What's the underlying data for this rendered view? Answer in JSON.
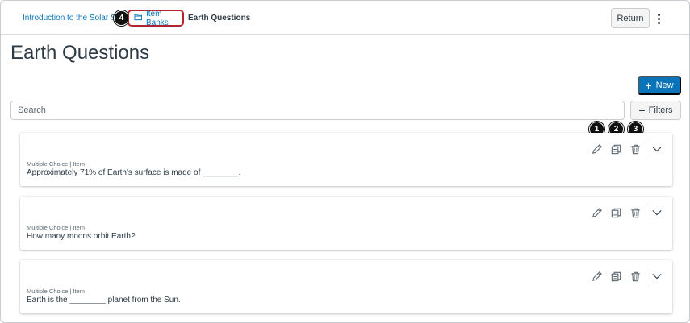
{
  "breadcrumb": {
    "course": "Introduction to the Solar System",
    "item_banks": "Item Banks",
    "current": "Earth Questions"
  },
  "header": {
    "return_label": "Return"
  },
  "page_title": "Earth Questions",
  "toolbar": {
    "new_label": "New",
    "search_placeholder": "Search",
    "filters_label": "Filters"
  },
  "markers": [
    "1",
    "2",
    "3",
    "4"
  ],
  "items": [
    {
      "meta": "Multiple Choice | Item",
      "text": "Approximately 71% of Earth's surface is made of ________."
    },
    {
      "meta": "Multiple Choice | Item",
      "text": "How many moons orbit Earth?"
    },
    {
      "meta": "Multiple Choice | Item",
      "text": "Earth is the ________ planet from the Sun."
    }
  ],
  "colors": {
    "link": "#0b74b8",
    "primary_button": "#0b74b8",
    "highlight_border": "#b3242d",
    "text": "#2d3b45"
  },
  "icons": [
    "item-banks-icon",
    "edit-icon",
    "copy-icon",
    "delete-icon",
    "chevron-down-icon",
    "more-options-icon",
    "plus-icon"
  ]
}
